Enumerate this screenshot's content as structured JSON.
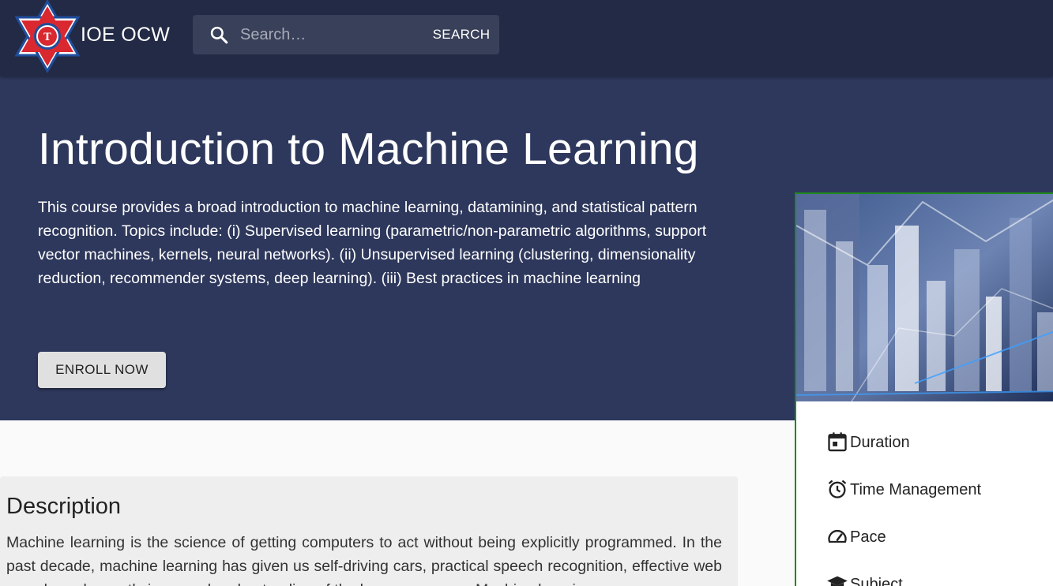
{
  "header": {
    "brand": "IOE OCW",
    "search": {
      "placeholder": "Search…",
      "button_label": "SEARCH"
    }
  },
  "hero": {
    "title": "Introduction to Machine Learning",
    "description": "This course provides a broad introduction to machine learning, datamining, and statistical pattern recognition. Topics include: (i) Supervised learning (parametric/non-parametric algorithms, support vector machines, kernels, neural networks). (ii) Unsupervised learning (clustering, dimensionality reduction, recommender systems, deep learning). (iii) Best practices in machine learning",
    "enroll_label": "ENROLL NOW"
  },
  "description_section": {
    "heading": "Description",
    "text": "Machine learning is the science of getting computers to act without being explicitly programmed. In the past decade, machine learning has given us self-driving cars, practical speech recognition, effective web search, and a vastly improved understanding of the human genome. Machine learning"
  },
  "course_card": {
    "meta": [
      {
        "icon": "calendar-icon",
        "label": "Duration"
      },
      {
        "icon": "alarm-clock-icon",
        "label": "Time Management"
      },
      {
        "icon": "speedometer-icon",
        "label": "Pace"
      },
      {
        "icon": "graduation-cap-icon",
        "label": "Subject"
      }
    ]
  },
  "colors": {
    "topbar": "#232a45",
    "hero": "#2e385c",
    "search_bg": "#394059",
    "card_border": "#1e8a1e"
  }
}
